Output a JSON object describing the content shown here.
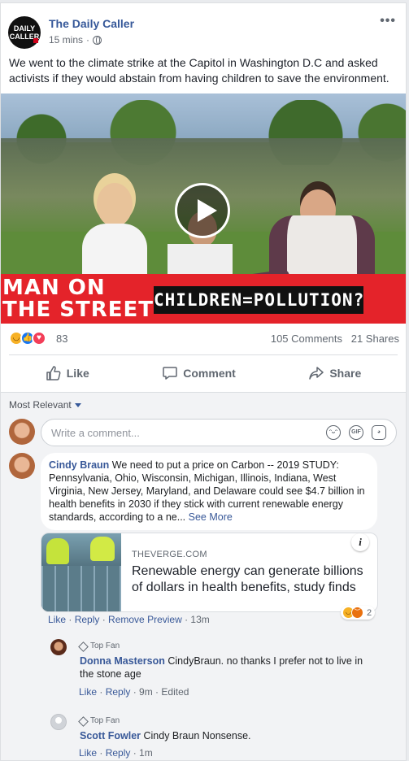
{
  "post": {
    "page_name": "The Daily Caller",
    "page_logo_line1": "DAILY",
    "page_logo_line2": "CALLER",
    "timestamp": "15 mins",
    "separator": "·",
    "text": "We went to the climate strike at the Capitol in Washington D.C and asked activists if they would abstain from having children to save the environment."
  },
  "video": {
    "banner_left": "MAN ON\nTHE STREET",
    "banner_right": "CHILDREN=POLLUTION?",
    "play_icon": "play-icon"
  },
  "stats": {
    "reactions": [
      "haha",
      "like",
      "love"
    ],
    "reaction_count": "83",
    "comments": "105 Comments",
    "shares": "21 Shares"
  },
  "actions": {
    "like": "Like",
    "comment": "Comment",
    "share": "Share"
  },
  "comments_section": {
    "sort_label": "Most Relevant",
    "input_placeholder": "Write a comment...",
    "input_icons": [
      "emoji-icon",
      "gif-icon",
      "sticker-icon"
    ],
    "gif_label": "GIF"
  },
  "comment1": {
    "author": "Cindy Braun",
    "text": " We need to put a price on Carbon -- 2019 STUDY: Pennsylvania, Ohio, Wisconsin, Michigan, Illinois, Indiana, West Virginia, New Jersey, Maryland, and Delaware could see $4.7 billion in health benefits in 2030 if they stick with current renewable energy standards, according to a ne... ",
    "see_more": "See More",
    "link_domain": "THEVERGE.COM",
    "link_title": "Renewable energy can generate billions of dollars in health benefits, study finds",
    "info": "i",
    "reaction_count": "2",
    "like": "Like",
    "reply": "Reply",
    "remove_preview": "Remove Preview",
    "time": "13m",
    "dot": " · "
  },
  "reply1": {
    "badge": "Top Fan",
    "author": "Donna Masterson",
    "text": " CindyBraun. no thanks I prefer not to live in the stone age",
    "like": "Like",
    "reply": "Reply",
    "time": "9m",
    "edited": "Edited",
    "dot": " · "
  },
  "reply2": {
    "badge": "Top Fan",
    "author": "Scott Fowler",
    "text": " Cindy Braun Nonsense.",
    "like": "Like",
    "reply": "Reply",
    "time": "1m",
    "dot": " · "
  },
  "colors": {
    "brand_blue": "#365899",
    "banner_red": "#e4232a",
    "background": "#e9ebee"
  }
}
